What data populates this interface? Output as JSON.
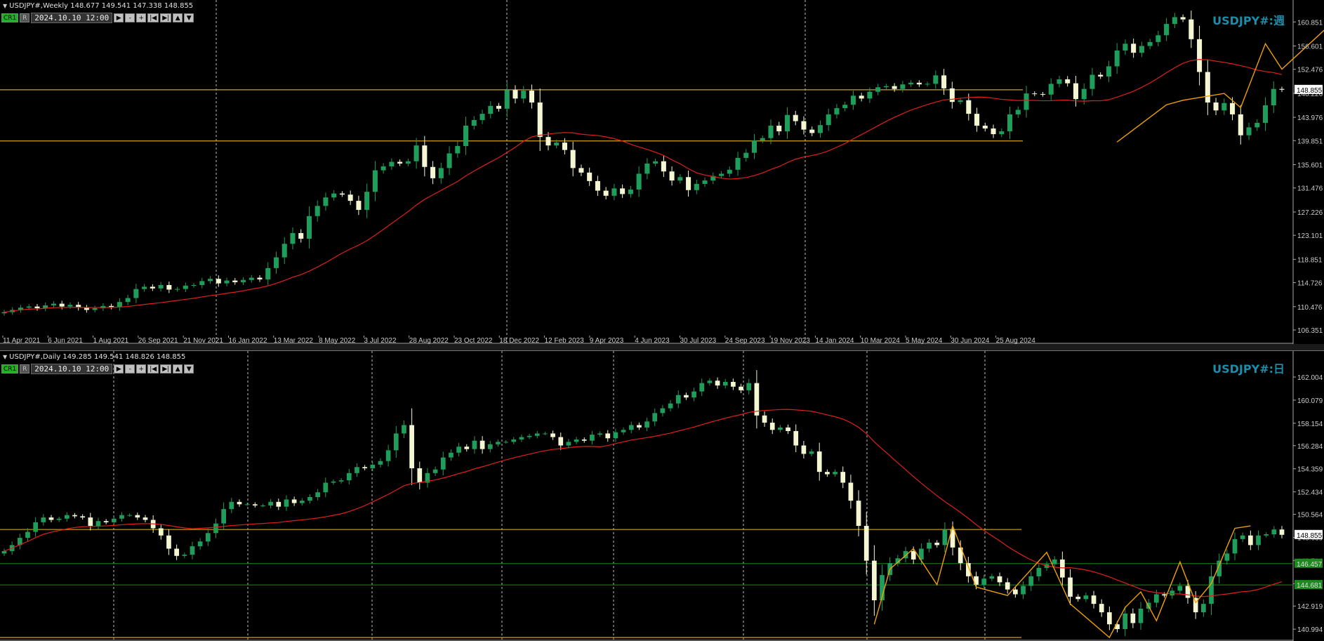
{
  "weekly": {
    "info": "USDJPY#,Weekly  148.677 149.541 147.338 148.855",
    "date": "2024.10.10 12:00",
    "label": "USDJPY#:週",
    "x_labels": [
      "11 Apr 2021",
      "6 Jun 2021",
      "1 Aug 2021",
      "26 Sep 2021",
      "21 Nov 2021",
      "16 Jan 2022",
      "13 Mar 2022",
      "8 May 2022",
      "3 Jul 2022",
      "28 Aug 2022",
      "23 Oct 2022",
      "18 Dec 2022",
      "12 Feb 2023",
      "9 Apr 2023",
      "4 Jun 2023",
      "30 Jul 2023",
      "24 Sep 2023",
      "19 Nov 2023",
      "14 Jan 2024",
      "10 Mar 2024",
      "5 May 2024",
      "30 Jun 2024",
      "25 Aug 2024"
    ],
    "y_labels": [
      "160.851",
      "156.601",
      "152.476",
      "148.226",
      "143.976",
      "139.851",
      "135.601",
      "131.476",
      "127.226",
      "123.101",
      "118.851",
      "114.726",
      "110.476",
      "106.351"
    ],
    "current_price": "148.855"
  },
  "daily": {
    "info": "USDJPY#,Daily  149.285 149.541 148.826 148.855",
    "date": "2024.10.10 12:00",
    "label": "USDJPY#:日",
    "y_labels": [
      "162.004",
      "160.079",
      "158.154",
      "156.284",
      "154.359",
      "152.434",
      "150.564",
      "148.639",
      "146.714",
      "144.789",
      "142.919",
      "140.994"
    ],
    "current_price": "148.855",
    "hline_prices": [
      "146.457",
      "144.681"
    ]
  },
  "toolbar": {
    "cr1": "CR1",
    "r": "R",
    "play": "▶",
    "minus": "-",
    "plus": "+",
    "first": "|◀",
    "last": "▶|",
    "up": "▲",
    "down": "▼"
  },
  "colors": {
    "bull": "#1e9e5a",
    "bear": "#f4f7d2",
    "ma": "#e0201a",
    "zigzag": "#f0a000",
    "hline": "#d4a017",
    "green_line": "#1c8a1c",
    "accent": "#1c8da8"
  },
  "chart_data": [
    {
      "type": "candlestick",
      "title": "USDJPY#,Weekly",
      "ylim": [
        106.351,
        162.5
      ],
      "x_start": "11 Apr 2021",
      "x_end": "10 Oct 2024",
      "price_path": [
        109.5,
        109.9,
        110.3,
        110.5,
        110.2,
        110.7,
        111.0,
        110.5,
        110.8,
        110.3,
        109.9,
        110.2,
        110.6,
        110.4,
        111.3,
        112.0,
        113.6,
        114.0,
        113.7,
        114.3,
        113.5,
        113.6,
        114.2,
        114.3,
        115.0,
        115.4,
        114.6,
        115.1,
        114.8,
        115.2,
        115.6,
        115.3,
        117.3,
        119.2,
        121.6,
        123.5,
        122.5,
        126.5,
        128.3,
        129.8,
        130.5,
        130.3,
        129.2,
        127.6,
        130.8,
        134.6,
        135.3,
        136.1,
        135.8,
        136.2,
        139.0,
        135.2,
        133.2,
        135.0,
        137.6,
        138.9,
        142.5,
        143.5,
        144.6,
        146.0,
        145.5,
        148.8,
        147.3,
        148.7,
        146.6,
        140.5,
        139.0,
        139.5,
        138.2,
        135.0,
        134.2,
        132.7,
        131.0,
        130.1,
        131.4,
        130.4,
        131.2,
        134.0,
        135.8,
        136.2,
        134.4,
        132.8,
        133.4,
        131.1,
        132.2,
        132.8,
        133.6,
        134.0,
        134.7,
        136.8,
        137.7,
        139.9,
        140.3,
        142.5,
        141.5,
        144.4,
        143.3,
        141.8,
        141.2,
        142.6,
        144.5,
        145.6,
        146.2,
        147.8,
        147.3,
        148.5,
        149.3,
        149.5,
        149.0,
        149.8,
        150.1,
        149.8,
        149.9,
        151.4,
        149.1,
        146.7,
        147.0,
        144.6,
        142.5,
        142.0,
        141.0,
        141.5,
        144.5,
        145.3,
        148.2,
        148.1,
        148.0,
        149.9,
        150.7,
        150.0,
        147.2,
        149.0,
        151.5,
        151.2,
        153.0,
        155.8,
        157.0,
        155.4,
        156.6,
        157.3,
        158.5,
        160.5,
        161.7,
        161.3,
        157.8,
        152.0,
        146.6,
        145.2,
        146.5,
        144.5,
        140.8,
        142.2,
        143.0,
        146.1,
        149.0,
        148.855
      ],
      "ma_period": 20,
      "hlines": [
        148.855,
        139.8
      ],
      "zigzag_pts": [
        [
          135,
          139.6
        ],
        [
          141,
          146.2
        ],
        [
          143,
          147.0
        ],
        [
          148,
          148.2
        ],
        [
          150,
          145.7
        ],
        [
          153,
          157.0
        ],
        [
          155,
          152.5
        ],
        [
          162,
          161.9
        ],
        [
          166,
          147.4
        ],
        [
          168,
          149.4
        ],
        [
          170,
          141.7
        ],
        [
          172,
          145.2
        ],
        [
          175,
          140.8
        ],
        [
          178,
          149.0
        ]
      ]
    },
    {
      "type": "candlestick",
      "title": "USDJPY#,Daily",
      "ylim": [
        140.3,
        163.0
      ],
      "x_start": "2024-03",
      "x_end": "2024-10-10",
      "price_path": [
        147.5,
        148.0,
        148.6,
        149.1,
        149.9,
        150.3,
        150.1,
        150.2,
        150.5,
        150.4,
        150.3,
        149.6,
        150.0,
        149.9,
        150.2,
        150.5,
        150.5,
        150.3,
        150.1,
        149.4,
        148.8,
        147.7,
        147.1,
        147.2,
        147.9,
        148.3,
        149.0,
        149.8,
        151.0,
        151.6,
        151.4,
        151.4,
        151.3,
        151.3,
        151.6,
        151.2,
        151.8,
        151.5,
        151.7,
        152.0,
        152.4,
        153.2,
        153.3,
        153.4,
        154.0,
        154.5,
        154.4,
        154.7,
        155.0,
        155.9,
        157.3,
        158.0,
        154.4,
        153.2,
        154.0,
        154.3,
        155.3,
        155.7,
        156.2,
        156.0,
        156.7,
        156.0,
        156.4,
        156.6,
        156.6,
        156.8,
        157.0,
        157.1,
        157.3,
        157.3,
        157.0,
        156.3,
        156.6,
        156.8,
        156.7,
        157.2,
        157.3,
        156.9,
        157.4,
        157.6,
        158.0,
        157.8,
        158.3,
        159.0,
        159.4,
        159.8,
        160.5,
        160.3,
        160.8,
        161.5,
        161.7,
        161.3,
        161.6,
        161.2,
        160.9,
        161.5,
        158.8,
        158.2,
        157.6,
        157.8,
        157.5,
        156.3,
        155.6,
        155.8,
        154.1,
        153.9,
        154.1,
        153.2,
        151.7,
        149.6,
        146.7,
        143.4,
        145.5,
        146.5,
        146.9,
        147.5,
        146.8,
        147.7,
        148.2,
        148.0,
        149.3,
        147.8,
        146.5,
        145.4,
        144.7,
        145.2,
        145.4,
        144.9,
        144.3,
        143.9,
        144.6,
        145.4,
        146.1,
        146.4,
        146.8,
        145.3,
        143.7,
        143.5,
        143.8,
        143.1,
        142.4,
        141.4,
        141.0,
        142.3,
        141.5,
        142.7,
        143.2,
        143.9,
        143.8,
        144.2,
        144.6,
        143.6,
        142.4,
        143.1,
        145.4,
        146.7,
        147.3,
        148.5,
        148.8,
        148.0,
        148.8,
        148.9,
        149.3,
        148.855
      ],
      "ma_period": 25,
      "hlines": [
        149.3,
        140.3
      ],
      "green_hlines": [
        146.457,
        144.681
      ],
      "zigzag_pts": [
        [
          111,
          141.4
        ],
        [
          113,
          146.0
        ],
        [
          116,
          147.7
        ],
        [
          119,
          144.7
        ],
        [
          121,
          149.6
        ],
        [
          124,
          144.5
        ],
        [
          128,
          143.8
        ],
        [
          133,
          147.4
        ],
        [
          136,
          143.1
        ],
        [
          141,
          140.3
        ],
        [
          143,
          142.8
        ],
        [
          145,
          144.1
        ],
        [
          147,
          141.7
        ],
        [
          150,
          146.6
        ],
        [
          152,
          143.2
        ],
        [
          154,
          144.8
        ],
        [
          157,
          149.4
        ],
        [
          159,
          149.6
        ]
      ]
    }
  ]
}
